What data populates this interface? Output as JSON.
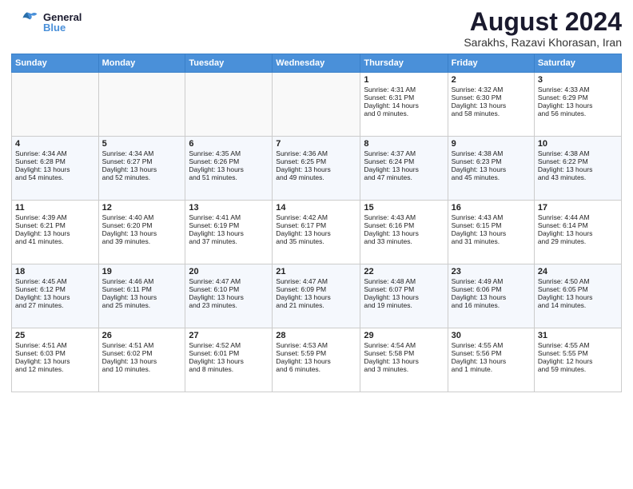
{
  "header": {
    "logo_general": "General",
    "logo_blue": "Blue",
    "month_year": "August 2024",
    "location": "Sarakhs, Razavi Khorasan, Iran"
  },
  "weekdays": [
    "Sunday",
    "Monday",
    "Tuesday",
    "Wednesday",
    "Thursday",
    "Friday",
    "Saturday"
  ],
  "weeks": [
    [
      {
        "day": "",
        "info": ""
      },
      {
        "day": "",
        "info": ""
      },
      {
        "day": "",
        "info": ""
      },
      {
        "day": "",
        "info": ""
      },
      {
        "day": "1",
        "info": "Sunrise: 4:31 AM\nSunset: 6:31 PM\nDaylight: 14 hours\nand 0 minutes."
      },
      {
        "day": "2",
        "info": "Sunrise: 4:32 AM\nSunset: 6:30 PM\nDaylight: 13 hours\nand 58 minutes."
      },
      {
        "day": "3",
        "info": "Sunrise: 4:33 AM\nSunset: 6:29 PM\nDaylight: 13 hours\nand 56 minutes."
      }
    ],
    [
      {
        "day": "4",
        "info": "Sunrise: 4:34 AM\nSunset: 6:28 PM\nDaylight: 13 hours\nand 54 minutes."
      },
      {
        "day": "5",
        "info": "Sunrise: 4:34 AM\nSunset: 6:27 PM\nDaylight: 13 hours\nand 52 minutes."
      },
      {
        "day": "6",
        "info": "Sunrise: 4:35 AM\nSunset: 6:26 PM\nDaylight: 13 hours\nand 51 minutes."
      },
      {
        "day": "7",
        "info": "Sunrise: 4:36 AM\nSunset: 6:25 PM\nDaylight: 13 hours\nand 49 minutes."
      },
      {
        "day": "8",
        "info": "Sunrise: 4:37 AM\nSunset: 6:24 PM\nDaylight: 13 hours\nand 47 minutes."
      },
      {
        "day": "9",
        "info": "Sunrise: 4:38 AM\nSunset: 6:23 PM\nDaylight: 13 hours\nand 45 minutes."
      },
      {
        "day": "10",
        "info": "Sunrise: 4:38 AM\nSunset: 6:22 PM\nDaylight: 13 hours\nand 43 minutes."
      }
    ],
    [
      {
        "day": "11",
        "info": "Sunrise: 4:39 AM\nSunset: 6:21 PM\nDaylight: 13 hours\nand 41 minutes."
      },
      {
        "day": "12",
        "info": "Sunrise: 4:40 AM\nSunset: 6:20 PM\nDaylight: 13 hours\nand 39 minutes."
      },
      {
        "day": "13",
        "info": "Sunrise: 4:41 AM\nSunset: 6:19 PM\nDaylight: 13 hours\nand 37 minutes."
      },
      {
        "day": "14",
        "info": "Sunrise: 4:42 AM\nSunset: 6:17 PM\nDaylight: 13 hours\nand 35 minutes."
      },
      {
        "day": "15",
        "info": "Sunrise: 4:43 AM\nSunset: 6:16 PM\nDaylight: 13 hours\nand 33 minutes."
      },
      {
        "day": "16",
        "info": "Sunrise: 4:43 AM\nSunset: 6:15 PM\nDaylight: 13 hours\nand 31 minutes."
      },
      {
        "day": "17",
        "info": "Sunrise: 4:44 AM\nSunset: 6:14 PM\nDaylight: 13 hours\nand 29 minutes."
      }
    ],
    [
      {
        "day": "18",
        "info": "Sunrise: 4:45 AM\nSunset: 6:12 PM\nDaylight: 13 hours\nand 27 minutes."
      },
      {
        "day": "19",
        "info": "Sunrise: 4:46 AM\nSunset: 6:11 PM\nDaylight: 13 hours\nand 25 minutes."
      },
      {
        "day": "20",
        "info": "Sunrise: 4:47 AM\nSunset: 6:10 PM\nDaylight: 13 hours\nand 23 minutes."
      },
      {
        "day": "21",
        "info": "Sunrise: 4:47 AM\nSunset: 6:09 PM\nDaylight: 13 hours\nand 21 minutes."
      },
      {
        "day": "22",
        "info": "Sunrise: 4:48 AM\nSunset: 6:07 PM\nDaylight: 13 hours\nand 19 minutes."
      },
      {
        "day": "23",
        "info": "Sunrise: 4:49 AM\nSunset: 6:06 PM\nDaylight: 13 hours\nand 16 minutes."
      },
      {
        "day": "24",
        "info": "Sunrise: 4:50 AM\nSunset: 6:05 PM\nDaylight: 13 hours\nand 14 minutes."
      }
    ],
    [
      {
        "day": "25",
        "info": "Sunrise: 4:51 AM\nSunset: 6:03 PM\nDaylight: 13 hours\nand 12 minutes."
      },
      {
        "day": "26",
        "info": "Sunrise: 4:51 AM\nSunset: 6:02 PM\nDaylight: 13 hours\nand 10 minutes."
      },
      {
        "day": "27",
        "info": "Sunrise: 4:52 AM\nSunset: 6:01 PM\nDaylight: 13 hours\nand 8 minutes."
      },
      {
        "day": "28",
        "info": "Sunrise: 4:53 AM\nSunset: 5:59 PM\nDaylight: 13 hours\nand 6 minutes."
      },
      {
        "day": "29",
        "info": "Sunrise: 4:54 AM\nSunset: 5:58 PM\nDaylight: 13 hours\nand 3 minutes."
      },
      {
        "day": "30",
        "info": "Sunrise: 4:55 AM\nSunset: 5:56 PM\nDaylight: 13 hours\nand 1 minute."
      },
      {
        "day": "31",
        "info": "Sunrise: 4:55 AM\nSunset: 5:55 PM\nDaylight: 12 hours\nand 59 minutes."
      }
    ]
  ]
}
